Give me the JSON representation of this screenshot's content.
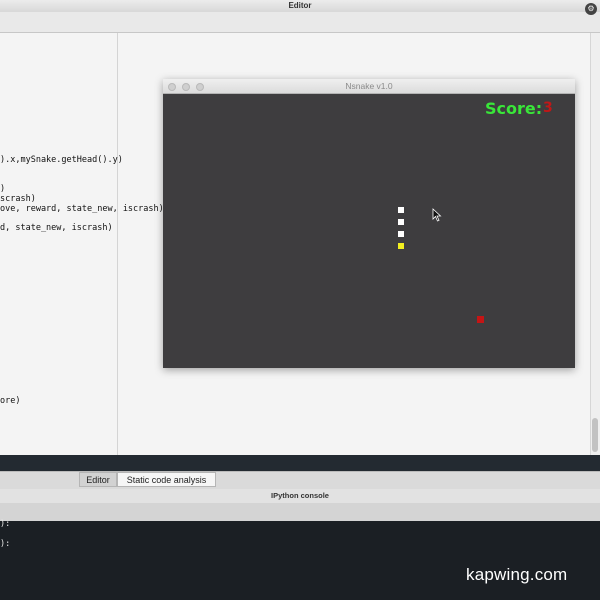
{
  "editor": {
    "title": "Editor",
    "code_lines": [
      ").x,mySnake.getHead().y)",
      ")",
      "scrash)",
      "ove, reward, state_new, iscrash)",
      "d, state_new, iscrash)",
      "ore)"
    ]
  },
  "tabs": [
    {
      "label": "Editor"
    },
    {
      "label": "Static code analysis"
    }
  ],
  "console": {
    "title": "IPython console",
    "lines": [
      "):",
      "):"
    ]
  },
  "game_window": {
    "title": "Nsnake v1.0",
    "score_label": "Score:",
    "score_value": "3",
    "colors": {
      "background": "#3e3d3f",
      "score_label": "#39e639",
      "score_value": "#c01717",
      "snake_body": "#ffffff",
      "snake_head": "#f2ef20",
      "food": "#c41515"
    }
  },
  "watermark": "kapwing.com",
  "icons": {
    "options": "gear-icon",
    "cursor": "mouse-pointer-icon"
  }
}
